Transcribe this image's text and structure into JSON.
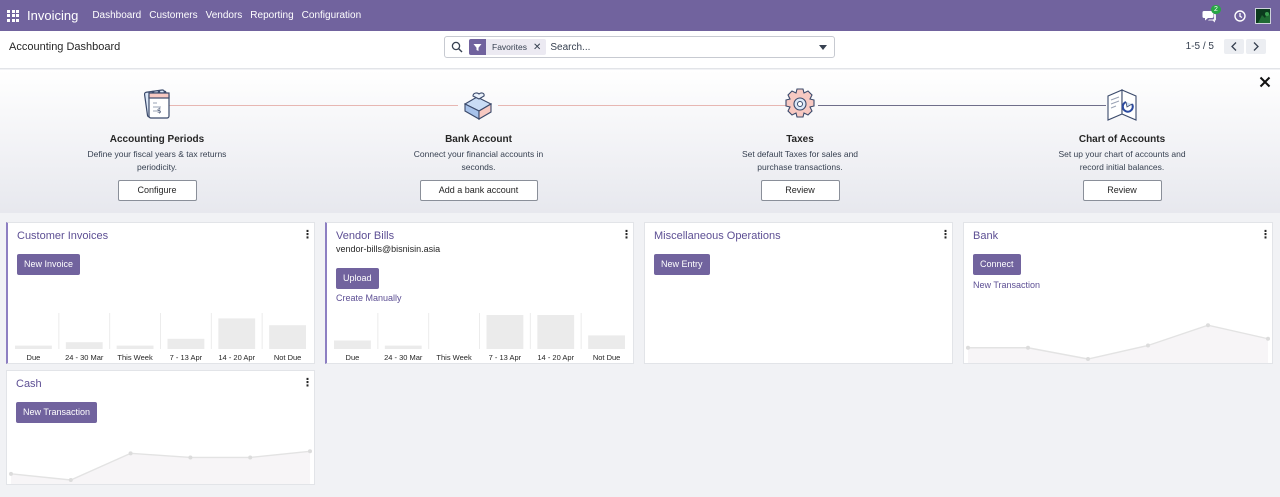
{
  "navbar": {
    "brand": "Invoicing",
    "menu": [
      "Dashboard",
      "Customers",
      "Vendors",
      "Reporting",
      "Configuration"
    ],
    "chat_count": "2",
    "color": "#71639e"
  },
  "control_panel": {
    "title": "Accounting Dashboard",
    "search": {
      "facet": "Favorites",
      "placeholder": "Search..."
    },
    "pager": "1-5 / 5"
  },
  "onboarding": {
    "steps": [
      {
        "icon": "calendar-icon",
        "title": "Accounting Periods",
        "desc_1": "Define your fiscal years & tax returns",
        "desc_2": "periodicity.",
        "button": "Configure"
      },
      {
        "icon": "bank-puzzle-icon",
        "title": "Bank Account",
        "desc_1": "Connect your financial accounts in",
        "desc_2": "seconds.",
        "button": "Add a bank account"
      },
      {
        "icon": "gear-icon",
        "title": "Taxes",
        "desc_1": "Set default Taxes for sales and",
        "desc_2": "purchase transactions.",
        "button": "Review"
      },
      {
        "icon": "chart-of-accounts-icon",
        "title": "Chart of Accounts",
        "desc_1": "Set up your chart of accounts and",
        "desc_2": "record initial balances.",
        "button": "Review"
      }
    ]
  },
  "cards": {
    "customer_invoices": {
      "title": "Customer Invoices",
      "button": "New Invoice"
    },
    "vendor_bills": {
      "title": "Vendor Bills",
      "email": "vendor-bills@bisnisin.asia",
      "button": "Upload",
      "link": "Create Manually"
    },
    "misc": {
      "title": "Miscellaneous Operations",
      "button": "New Entry"
    },
    "bank": {
      "title": "Bank",
      "button": "Connect",
      "link": "New Transaction"
    },
    "cash": {
      "title": "Cash",
      "button": "New Transaction"
    }
  },
  "chart_data": [
    {
      "type": "bar",
      "categories": [
        "Due",
        "24 - 30 Mar",
        "This Week",
        "7 - 13 Apr",
        "14 - 20 Apr",
        "Not Due"
      ],
      "values": [
        2,
        4,
        2,
        6,
        18,
        14
      ],
      "ylim": [
        0,
        20
      ],
      "color": "#ebebeb"
    },
    {
      "type": "bar",
      "categories": [
        "Due",
        "24 - 30 Mar",
        "This Week",
        "7 - 13 Apr",
        "14 - 20 Apr",
        "Not Due"
      ],
      "values": [
        5,
        2,
        0,
        20,
        20,
        8
      ],
      "ylim": [
        0,
        20
      ],
      "color": "#ebebeb"
    },
    {
      "type": "line",
      "values": [
        5,
        5,
        0,
        6,
        15,
        9
      ],
      "ylim": [
        0,
        20
      ],
      "color": "#e3e3e3"
    },
    {
      "type": "line",
      "values": [
        3,
        0,
        13,
        11,
        11,
        14
      ],
      "ylim": [
        0,
        20
      ],
      "color": "#e3e3e3"
    }
  ]
}
